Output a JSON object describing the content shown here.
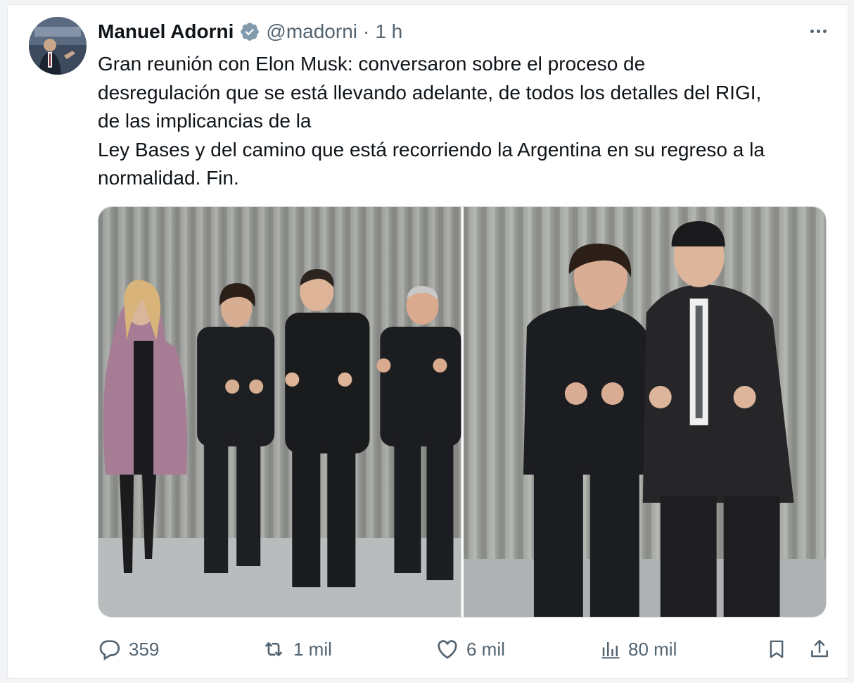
{
  "tweet": {
    "author_name": "Manuel Adorni",
    "author_handle": "@madorni",
    "separator": "·",
    "time": "1 h",
    "verified": true,
    "text_lines": [
      "Gran reunión con Elon Musk: conversaron sobre el proceso de",
      "desregulación que se está llevando adelante, de todos los detalles del RIGI,",
      "de las implicancias de la",
      "Ley Bases y del camino que está recorriendo la Argentina en su regreso a la",
      "normalidad. Fin."
    ],
    "media": [
      {
        "kind": "photo",
        "description_icon": "photo-image"
      },
      {
        "kind": "photo",
        "description_icon": "photo-image"
      }
    ]
  },
  "actions": {
    "replies": "359",
    "reposts": "1 mil",
    "likes": "6 mil",
    "views": "80 mil"
  },
  "icons": {
    "verified": "verified-badge-icon",
    "more": "more-icon",
    "reply": "reply-icon",
    "repost": "repost-icon",
    "like": "like-icon",
    "views": "views-icon",
    "bookmark": "bookmark-icon",
    "share": "share-icon"
  },
  "colors": {
    "text": "#0f1419",
    "secondary": "#536471",
    "verified_badge": "#829aab",
    "border": "#cfd9de"
  }
}
